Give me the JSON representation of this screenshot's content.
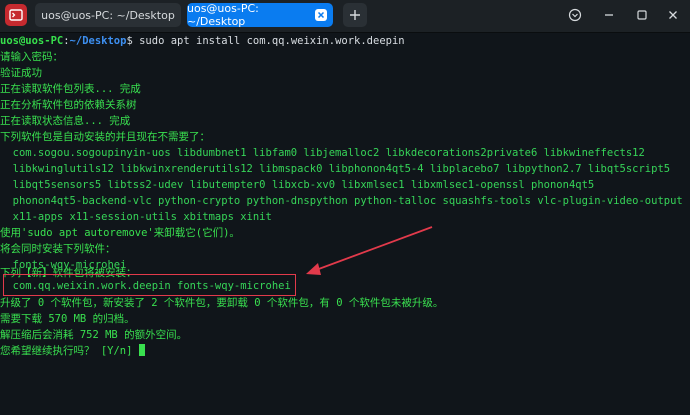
{
  "tabs": [
    {
      "label": "uos@uos-PC: ~/Desktop"
    },
    {
      "label": "uos@uos-PC: ~/Desktop"
    }
  ],
  "prompt": {
    "user_host": "uos@uos-PC",
    "sep": ":",
    "path": "~/Desktop",
    "symbol": "$",
    "command": " sudo apt install com.qq.weixin.work.deepin"
  },
  "output": {
    "password_prompt": "请输入密码：",
    "auth_ok": "验证成功",
    "reading_list": "正在读取软件包列表... 完成",
    "analyzing_deps": "正在分析软件包的依赖关系树",
    "reading_state": "正在读取状态信息... 完成",
    "auto_installed_header": "下列软件包是自动安装的并且现在不需要了：",
    "auto_pkgs": [
      "  com.sogou.sogoupinyin-uos libdumbnet1 libfam0 libjemalloc2 libkdecorations2private6 libkwineffects12",
      "  libkwinglutils12 libkwinxrenderutils12 libmspack0 libphonon4qt5-4 libplacebo7 libpython2.7 libqt5script5",
      "  libqt5sensors5 libtss2-udev libutempter0 libxcb-xv0 libxmlsec1 libxmlsec1-openssl phonon4qt5",
      "  phonon4qt5-backend-vlc python-crypto python-dnspython python-talloc squashfs-tools vlc-plugin-video-output",
      "  x11-apps x11-session-utils xbitmaps xinit"
    ],
    "autoremove_hint": "使用'sudo apt autoremove'来卸载它(它们)。",
    "extra_header": "将会同时安装下列软件：",
    "extra_pkgs": "  fonts-wqy-microhei",
    "new_header": "下列【新】软件包将被安装：",
    "new_pkgs": "  com.qq.weixin.work.deepin fonts-wqy-microhei",
    "summary": "升级了 0 个软件包，新安装了 2 个软件包，要卸载 0 个软件包，有 0 个软件包未被升级。",
    "download_size": "需要下载 570 MB 的归档。",
    "disk_usage": "解压缩后会消耗 752 MB 的额外空间。",
    "confirm": "您希望继续执行吗？ [Y/n] "
  },
  "colors": {
    "terminal_bg": "#10151a",
    "text_green": "#39e04f",
    "path_blue": "#3d8ff0",
    "active_tab": "#0a7cf0",
    "annotation_red": "#e23a4b"
  },
  "icons": [
    "app-logo-icon",
    "close-icon",
    "plus-icon",
    "settings-icon",
    "minimize-icon",
    "maximize-icon",
    "close-window-icon"
  ]
}
